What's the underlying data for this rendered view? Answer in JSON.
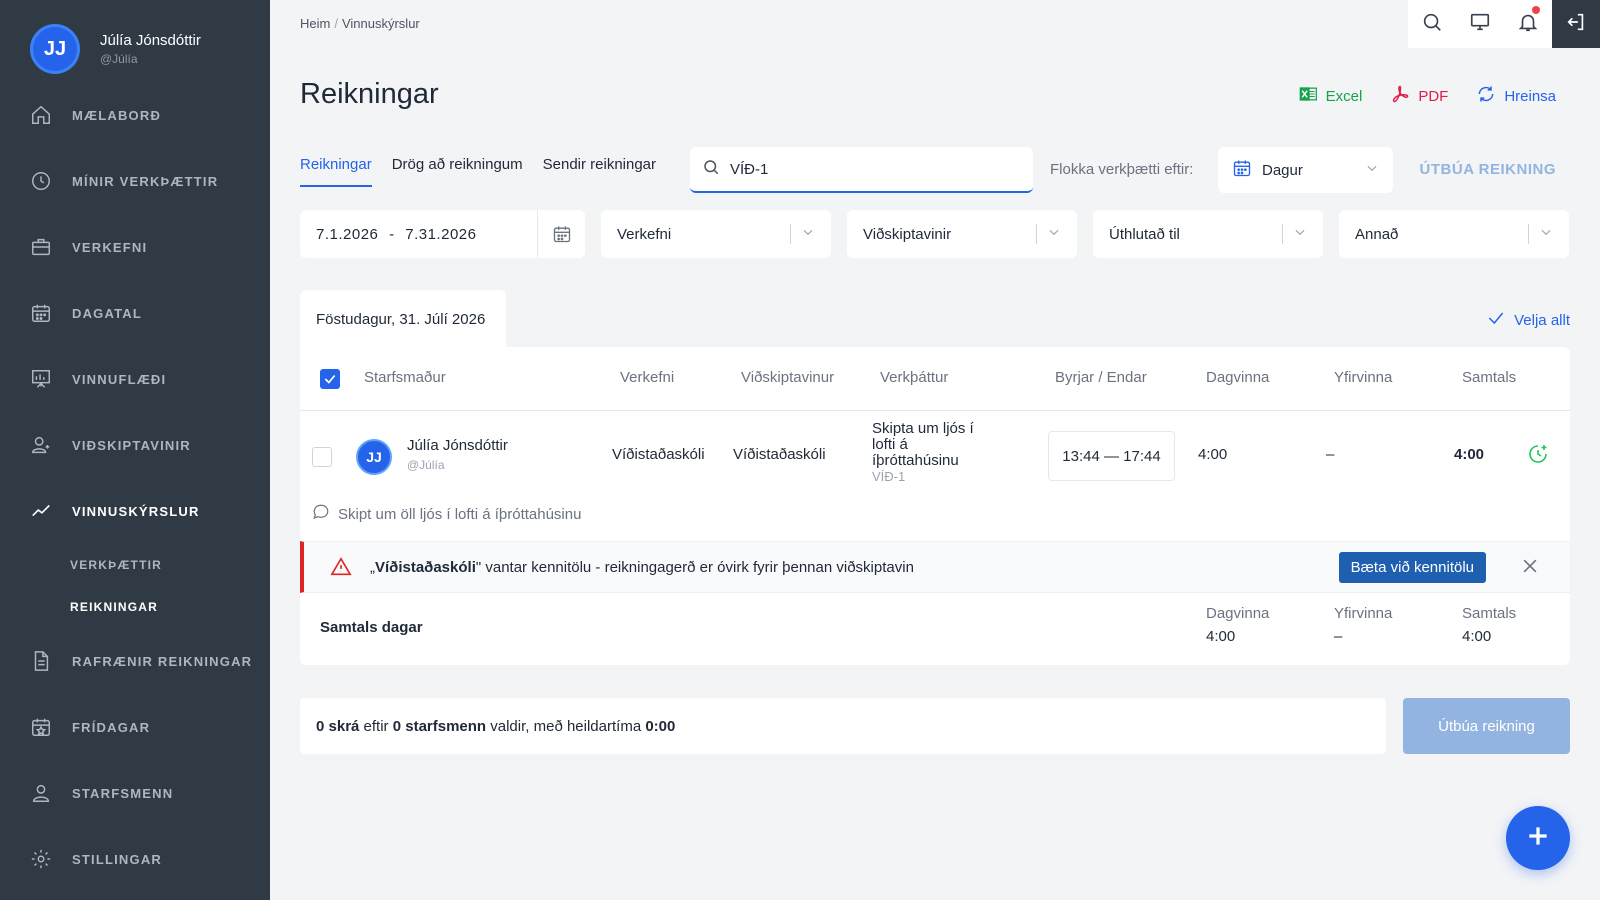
{
  "colors": {
    "sidebar_bg": "#2f3a45",
    "accent": "#2563eb",
    "danger": "#dc2626",
    "excel": "#16a34a",
    "pdf": "#e11d48"
  },
  "user": {
    "initials": "JJ",
    "name": "Júlía Jónsdóttir",
    "handle": "@Júlía"
  },
  "sidebar": {
    "items": [
      {
        "label": "MÆLABORÐ",
        "icon": "home-icon"
      },
      {
        "label": "MÍNIR VERKÞÆTTIR",
        "icon": "clock-icon"
      },
      {
        "label": "VERKEFNI",
        "icon": "briefcase-icon"
      },
      {
        "label": "DAGATAL",
        "icon": "calendar-icon"
      },
      {
        "label": "VINNUFLÆÐI",
        "icon": "workflow-icon"
      },
      {
        "label": "VIÐSKIPTAVINIR",
        "icon": "customer-icon"
      },
      {
        "label": "VINNUSKÝRSLUR",
        "icon": "chart-line-icon"
      },
      {
        "label": "RAFRÆNIR REIKNINGAR",
        "icon": "document-icon"
      },
      {
        "label": "FRÍDAGAR",
        "icon": "holiday-icon"
      },
      {
        "label": "STARFSMENN",
        "icon": "employees-icon"
      },
      {
        "label": "STILLINGAR",
        "icon": "gear-icon"
      }
    ],
    "subitems": [
      {
        "label": "VERKÞÆTTIR"
      },
      {
        "label": "REIKNINGAR"
      }
    ]
  },
  "breadcrumb": {
    "home": "Heim",
    "current": "Vinnuskýrslur"
  },
  "page": {
    "title": "Reikningar"
  },
  "actions": {
    "excel": "Excel",
    "pdf": "PDF",
    "clear": "Hreinsa"
  },
  "tabs": [
    {
      "label": "Reikningar"
    },
    {
      "label": "Drög að reikningum"
    },
    {
      "label": "Sendir reikningar"
    }
  ],
  "search": {
    "value": "VÍÐ-1"
  },
  "group": {
    "label": "Flokka verkþætti eftir:",
    "value": "Dagur"
  },
  "create_link": "ÚTBÚA REIKNING",
  "filters": {
    "date_from": "7.1.2026",
    "date_sep": "-",
    "date_to": "7.31.2026",
    "project": "Verkefni",
    "customer": "Viðskiptavinir",
    "assigned": "Úthlutað til",
    "other": "Annað"
  },
  "day": {
    "label": "Föstudagur, 31. Júlí 2026"
  },
  "select_all": "Velja allt",
  "table": {
    "headers": {
      "employee": "Starfsmaður",
      "project": "Verkefni",
      "customer": "Viðskiptavinur",
      "task": "Verkþáttur",
      "start_end": "Byrjar / Endar",
      "day_work": "Dagvinna",
      "overtime": "Yfirvinna",
      "total": "Samtals"
    },
    "row": {
      "initials": "JJ",
      "name": "Júlía Jónsdóttir",
      "handle": "@Júlía",
      "project": "Víðistaðaskóli",
      "customer": "Víðistaðaskóli",
      "task_line1": "Skipta um ljós í",
      "task_line2": "lofti á",
      "task_line3": "íþróttahúsinu",
      "task_code": "VÍÐ-1",
      "time": "13:44 — 17:44",
      "day_work": "4:00",
      "overtime": "–",
      "total": "4:00"
    },
    "comment": "Skipt um öll ljós í lofti á íþróttahúsinu"
  },
  "alert": {
    "open_quote": "„",
    "customer": "Víðistaðaskóli",
    "message": "\" vantar kennitölu - reikningagerð er óvirk fyrir þennan viðskiptavin",
    "button": "Bæta við kennitölu"
  },
  "totals": {
    "label": "Samtals dagar",
    "day_work_label": "Dagvinna",
    "day_work": "4:00",
    "overtime_label": "Yfirvinna",
    "overtime": "–",
    "total_label": "Samtals",
    "total": "4:00"
  },
  "summary": {
    "files": "0 skrá",
    "after": " eftir ",
    "employees": "0 starfsmenn",
    "selected": " valdir, með heildartíma ",
    "time": "0:00"
  },
  "create_button": "Útbúa reikning"
}
